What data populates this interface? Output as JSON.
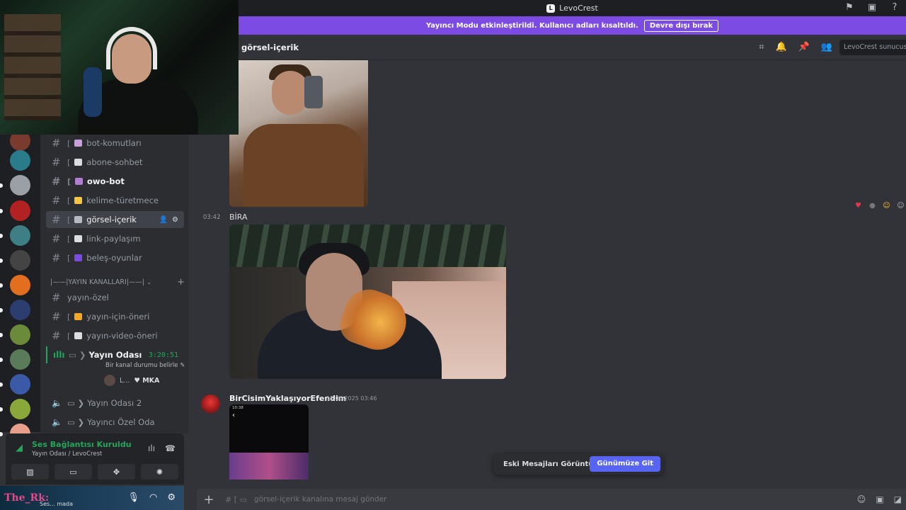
{
  "app": {
    "title": "LevoCrest"
  },
  "titlebar_icons": [
    "flag-icon",
    "inbox-icon",
    "help-icon"
  ],
  "banner": {
    "text": "Yayıncı Modu etkinleştirildi. Kullanıcı adları kısaltıldı.",
    "button": "Devre dışı bırak",
    "color": "#7b4be3"
  },
  "header": {
    "channel": "görsel-içerik",
    "search_placeholder": "LevoCrest sunucusunu ara"
  },
  "servers": {
    "colors": [
      "#7a3b2e",
      "#2a7c8a",
      "#9aa0a6",
      "#b22222",
      "#3e7f86",
      "#444",
      "#e36f1e",
      "#2c3e70",
      "#6b8b3a",
      "#5a7b5a",
      "#3a5aa8",
      "#8aa83a",
      "#e8a08a"
    ]
  },
  "channels": [
    {
      "name": "bot-komutları",
      "emoji_color": "#c9a0dc",
      "bold": false,
      "active": false
    },
    {
      "name": "abone-sohbet",
      "emoji_color": "#dbdee1",
      "bold": false,
      "active": false
    },
    {
      "name": "owo-bot",
      "emoji_color": "#b07fd0",
      "bold": true,
      "active": false
    },
    {
      "name": "kelime-türetmece",
      "emoji_color": "#f5c542",
      "bold": false,
      "active": false
    },
    {
      "name": "görsel-içerik",
      "emoji_color": "#b5bac1",
      "bold": false,
      "active": true
    },
    {
      "name": "link-paylaşım",
      "emoji_color": "#dbdee1",
      "bold": false,
      "active": false
    },
    {
      "name": "beleş-oyunlar",
      "emoji_color": "#7b4be3",
      "bold": false,
      "active": false
    }
  ],
  "category": {
    "label": "|——|YAYIN KANALLARI|——|"
  },
  "stream_channels": [
    {
      "name": "yayın-özel",
      "bracket": false,
      "emoji_color": ""
    },
    {
      "name": "yayın-için-öneri",
      "bracket": true,
      "emoji_color": "#f5a623"
    },
    {
      "name": "yayın-video-öneri",
      "bracket": true,
      "emoji_color": "#dbdee1"
    }
  ],
  "voice_live": {
    "name": "Yayın Odası",
    "timer": "3:20:51",
    "status": "Bir kanal durumu belirle",
    "user_short": "L...",
    "user_tag": "MKA"
  },
  "voice_channels": [
    {
      "name": "Yayın Odası 2"
    },
    {
      "name": "Yayıncı Özel Oda"
    }
  ],
  "voice_panel": {
    "status": "Ses Bağlantısı Kuruldu",
    "sub": "Yayın Odası / LevoCrest"
  },
  "user_panel": {
    "name": "The_Rk:",
    "status": "Ses... mada"
  },
  "messages": {
    "m1_time": "03:42",
    "m1_text": "BİRA",
    "m2_author": "BirCisimYaklaşıyorEfendim",
    "m2_date": "15.06.2025 03:46",
    "m2_preview_time": "10:38",
    "reactions": [
      {
        "glyph": "♥",
        "color": "#e8344a"
      },
      {
        "glyph": "●",
        "color": "#777"
      },
      {
        "glyph": "☺",
        "color": "#f5c542"
      },
      {
        "glyph": "☺",
        "color": "#b5bac1"
      }
    ]
  },
  "jump_bar": {
    "text": "Eski Mesajları Görüntülüyorsun",
    "button": "Günümüze Git"
  },
  "composer": {
    "placeholder": "görsel-içerik kanalına mesaj gönder"
  }
}
